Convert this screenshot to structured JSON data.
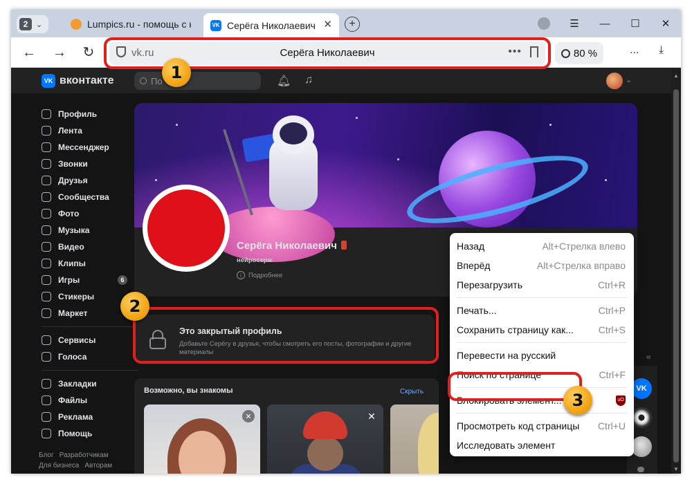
{
  "browser": {
    "tab_count": "2",
    "tabs": [
      {
        "title": "Lumpics.ru - помощь с ком",
        "icon": "lumpics-favicon"
      },
      {
        "title": "Серёга Николаевич",
        "icon": "vk-favicon"
      }
    ],
    "address_domain": "vk.ru",
    "address_title": "Серёга Николаевич",
    "zoom": "80 %",
    "more_label": "..."
  },
  "vk": {
    "logo_text": "VK",
    "brand": "вконтакте",
    "search_placeholder": "По",
    "menu": [
      {
        "label": "Профиль",
        "icon": "profile-icon"
      },
      {
        "label": "Лента",
        "icon": "feed-icon"
      },
      {
        "label": "Мессенджер",
        "icon": "messenger-icon"
      },
      {
        "label": "Звонки",
        "icon": "calls-icon"
      },
      {
        "label": "Друзья",
        "icon": "friends-icon"
      },
      {
        "label": "Сообщества",
        "icon": "communities-icon"
      },
      {
        "label": "Фото",
        "icon": "photo-icon"
      },
      {
        "label": "Музыка",
        "icon": "music-icon"
      },
      {
        "label": "Видео",
        "icon": "video-icon"
      },
      {
        "label": "Клипы",
        "icon": "clips-icon"
      },
      {
        "label": "Игры",
        "icon": "games-icon",
        "badge": "6"
      },
      {
        "label": "Стикеры",
        "icon": "stickers-icon"
      },
      {
        "label": "Маркет",
        "icon": "market-icon"
      },
      {
        "label": "Сервисы",
        "icon": "services-icon"
      },
      {
        "label": "Голоса",
        "icon": "votes-icon"
      },
      {
        "label": "Закладки",
        "icon": "bookmarks-icon"
      },
      {
        "label": "Файлы",
        "icon": "files-icon"
      },
      {
        "label": "Реклама",
        "icon": "ads-icon"
      },
      {
        "label": "Помощь",
        "icon": "help-icon"
      }
    ],
    "footer": {
      "blog": "Блог",
      "dev": "Разработчикам",
      "business": "Для бизнеса",
      "authors": "Авторам"
    },
    "profile": {
      "name": "Серёга Николаевич",
      "status": "нейросерж",
      "more": "Подробнее"
    },
    "closed": {
      "title": "Это закрытый профиль",
      "desc": "Добавьте Серёгу в друзья, чтобы смотреть его посты, фотографии и другие материалы"
    },
    "people": {
      "title": "Возможно, вы знакомы",
      "hide": "Скрыть"
    }
  },
  "context_menu": {
    "items": [
      {
        "label": "Назад",
        "shortcut": "Alt+Стрелка влево"
      },
      {
        "label": "Вперёд",
        "shortcut": "Alt+Стрелка вправо"
      },
      {
        "label": "Перезагрузить",
        "shortcut": "Ctrl+R"
      },
      {
        "label": "Печать...",
        "shortcut": "Ctrl+P"
      },
      {
        "label": "Сохранить страницу как...",
        "shortcut": "Ctrl+S"
      },
      {
        "label": "Перевести на русский",
        "shortcut": ""
      },
      {
        "label": "Поиск по странице",
        "shortcut": "Ctrl+F"
      },
      {
        "label": "Блокировать элемент...",
        "shortcut": "",
        "icon": "ublock-icon"
      },
      {
        "label": "Просмотреть код страницы",
        "shortcut": "Ctrl+U"
      },
      {
        "label": "Исследовать элемент",
        "shortcut": ""
      }
    ]
  },
  "markers": [
    "1",
    "2",
    "3"
  ],
  "colors": {
    "highlight": "#e01f1f",
    "marker": "#f2a516",
    "vk_blue": "#0077ff",
    "link": "#71aaeb"
  }
}
